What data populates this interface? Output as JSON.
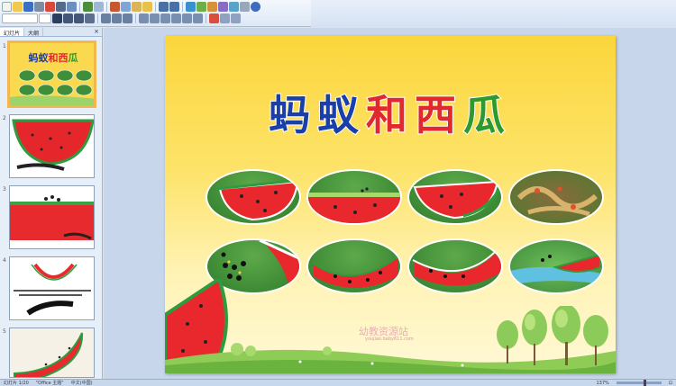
{
  "panel": {
    "tabs": [
      "幻灯片",
      "大纲"
    ],
    "close": "×"
  },
  "thumbnails": [
    {
      "number": "1"
    },
    {
      "number": "2"
    },
    {
      "number": "3"
    },
    {
      "number": "4"
    },
    {
      "number": "5"
    }
  ],
  "slide": {
    "title_chars": [
      "蚂",
      "蚁",
      "和",
      "西",
      "瓜"
    ],
    "title_colors": [
      "#1b3fa8",
      "#1b3fa8",
      "#e0282e",
      "#e0282e",
      "#2e9a2e"
    ],
    "watermark": "幼教资源站",
    "watermark_sub": "youjiao.baby611.com"
  },
  "status": {
    "slide_info": "幻灯片 1/20",
    "theme": "\"Office 主题\"",
    "language": "中文(中国)",
    "zoom": "137%"
  },
  "icons": [
    "new-icon",
    "open-icon",
    "save-icon",
    "print-icon",
    "undo-icon",
    "redo-icon",
    "bold-icon",
    "italic-icon",
    "underline-icon",
    "align-left-icon",
    "align-center-icon",
    "align-right-icon",
    "bullets-icon",
    "help-icon"
  ]
}
